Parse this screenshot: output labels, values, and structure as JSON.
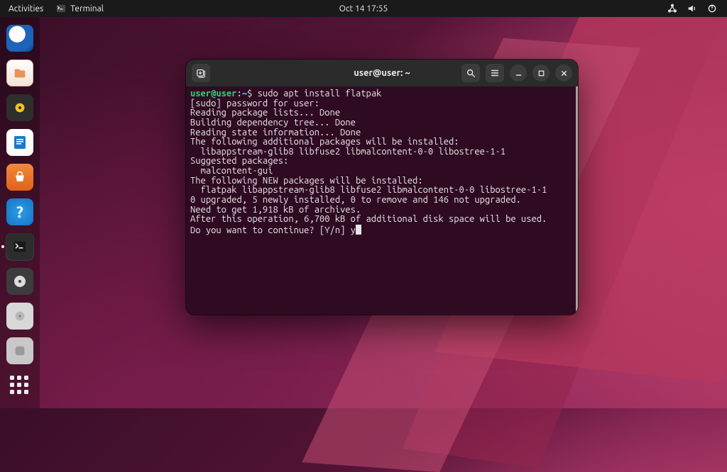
{
  "topbar": {
    "activities": "Activities",
    "app_label": "Terminal",
    "clock": "Oct 14  17:55"
  },
  "dock": {
    "apps": [
      {
        "name": "thunderbird-icon"
      },
      {
        "name": "files-icon"
      },
      {
        "name": "rhythmbox-icon"
      },
      {
        "name": "libreoffice-writer-icon"
      },
      {
        "name": "software-icon"
      },
      {
        "name": "help-icon"
      },
      {
        "name": "terminal-icon"
      },
      {
        "name": "disc-icon"
      },
      {
        "name": "disk-utility-icon"
      },
      {
        "name": "device-icon"
      }
    ]
  },
  "window": {
    "title": "user@user: ~",
    "icons": {
      "newtab": "new-tab-icon",
      "search": "search-icon",
      "menu": "hamburger-icon",
      "min": "minimize-icon",
      "max": "maximize-icon",
      "close": "close-icon"
    }
  },
  "terminal": {
    "prompt_user": "user@user",
    "prompt_sep": ":",
    "prompt_path": "~",
    "prompt_dollar": "$ ",
    "command": "sudo apt install flatpak",
    "lines": [
      "[sudo] password for user:",
      "Reading package lists... Done",
      "Building dependency tree... Done",
      "Reading state information... Done",
      "The following additional packages will be installed:",
      "  libappstream-glib8 libfuse2 libmalcontent-0-0 libostree-1-1",
      "Suggested packages:",
      "  malcontent-gui",
      "The following NEW packages will be installed:",
      "  flatpak libappstream-glib8 libfuse2 libmalcontent-0-0 libostree-1-1",
      "0 upgraded, 5 newly installed, 0 to remove and 146 not upgraded.",
      "Need to get 1,918 kB of archives.",
      "After this operation, 6,700 kB of additional disk space will be used.",
      "Do you want to continue? [Y/n] y"
    ]
  }
}
